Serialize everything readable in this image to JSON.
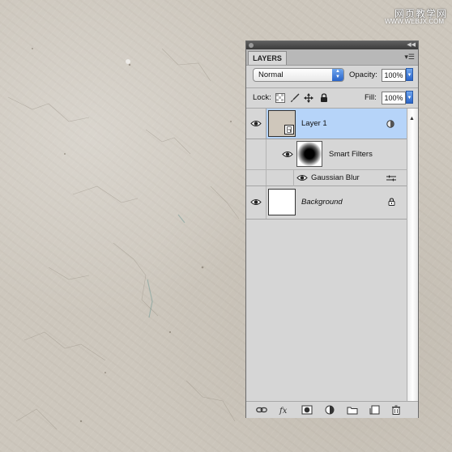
{
  "watermark": {
    "text": "网页教学网",
    "sub": "WWW.WEBJX.COM"
  },
  "panel": {
    "tab_label": "LAYERS",
    "blend_mode": "Normal",
    "opacity_label": "Opacity:",
    "opacity_value": "100%",
    "lock_label": "Lock:",
    "fill_label": "Fill:",
    "fill_value": "100%"
  },
  "layers": [
    {
      "name": "Layer 1",
      "selected": true,
      "visible": true,
      "smart_object": true
    },
    {
      "name": "Smart Filters",
      "visible": true
    },
    {
      "name": "Gaussian Blur",
      "visible": true
    },
    {
      "name": "Background",
      "visible": true,
      "locked": true
    }
  ],
  "bottom_icons": [
    "link-icon",
    "fx-icon",
    "mask-icon",
    "adjustment-icon",
    "folder-icon",
    "new-layer-icon",
    "trash-icon"
  ],
  "colors": {
    "selection": "#b6d4f9",
    "panel_bg": "#d6d6d6",
    "accent": "#2a64c8"
  }
}
